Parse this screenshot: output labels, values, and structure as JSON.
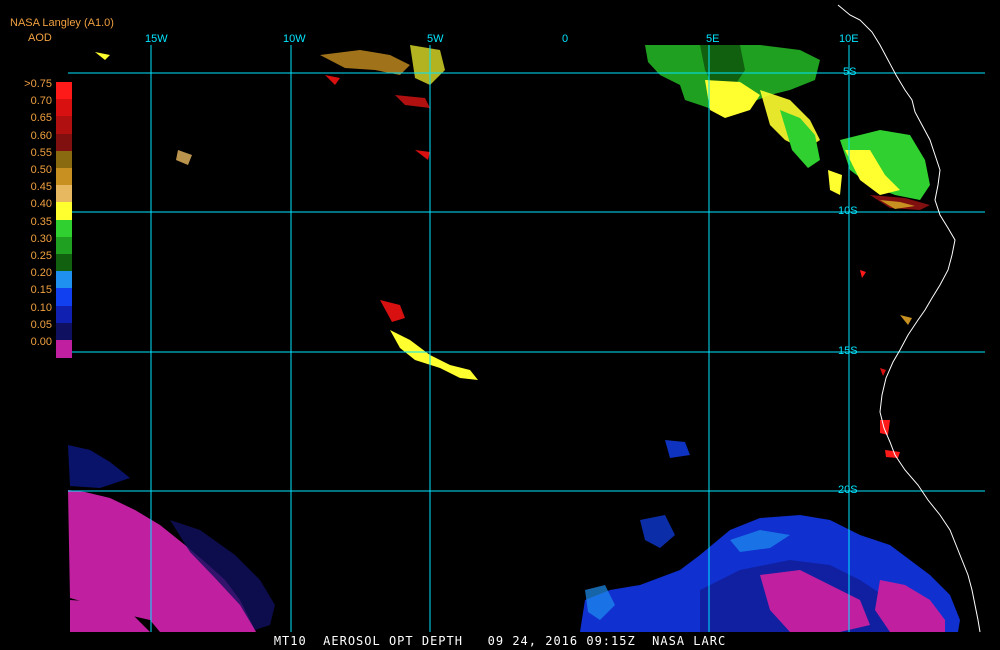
{
  "header": {
    "source": "NASA Langley (A1.0)",
    "variable": "AOD"
  },
  "colorbar": [
    {
      "label": ">0.75",
      "color": "#ff1a1a"
    },
    {
      "label": "0.70",
      "color": "#d81010"
    },
    {
      "label": "0.65",
      "color": "#b01010"
    },
    {
      "label": "0.60",
      "color": "#801010"
    },
    {
      "label": "0.55",
      "color": "#8a6a10"
    },
    {
      "label": "0.50",
      "color": "#c89020"
    },
    {
      "label": "0.45",
      "color": "#e8b860"
    },
    {
      "label": "0.40",
      "color": "#ffff30"
    },
    {
      "label": "0.35",
      "color": "#30d030"
    },
    {
      "label": "0.30",
      "color": "#20a020"
    },
    {
      "label": "0.25",
      "color": "#106010"
    },
    {
      "label": "0.20",
      "color": "#2090f0"
    },
    {
      "label": "0.15",
      "color": "#1040f0"
    },
    {
      "label": "0.10",
      "color": "#1020b0"
    },
    {
      "label": "0.05",
      "color": "#101060"
    },
    {
      "label": "0.00",
      "color": "#c020a0"
    }
  ],
  "axes": {
    "longitude_labels": [
      "15W",
      "10W",
      "5W",
      "0",
      "5E",
      "10E"
    ],
    "latitude_labels": [
      "5S",
      "10S",
      "15S",
      "20S"
    ]
  },
  "footer": "MT10  AEROSOL OPT DEPTH   09 24, 2016 09:15Z  NASA LARC",
  "colors": {
    "grid": "#00e5ff",
    "label": "#f0a040",
    "coastline": "#ffffff"
  }
}
